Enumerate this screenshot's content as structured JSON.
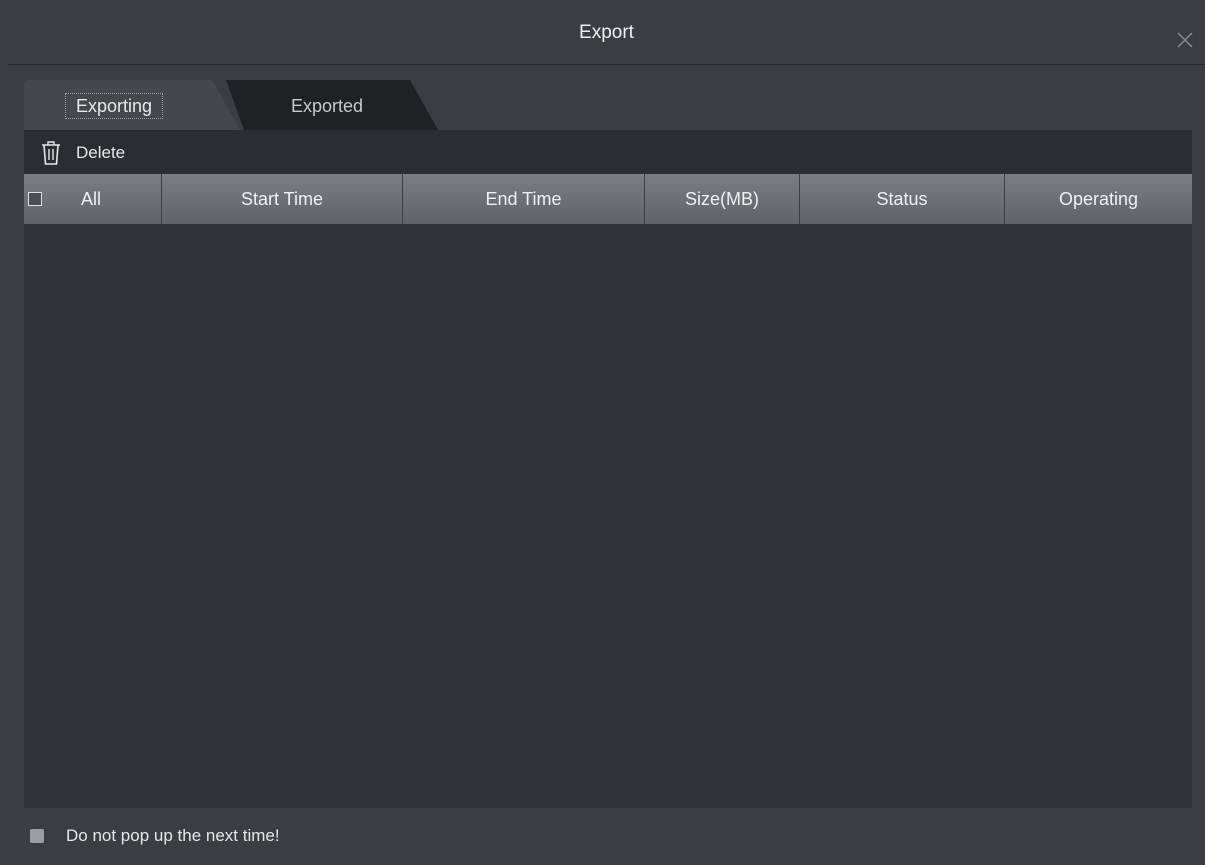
{
  "dialog": {
    "title": "Export"
  },
  "tabs": [
    {
      "label": "Exporting",
      "active": true
    },
    {
      "label": "Exported",
      "active": false
    }
  ],
  "toolbar": {
    "delete_label": "Delete",
    "delete_icon": "trash-icon"
  },
  "table": {
    "columns": [
      "All",
      "Start Time",
      "End Time",
      "Size(MB)",
      "Status",
      "Operating"
    ],
    "rows": []
  },
  "footer": {
    "dont_popup_label": "Do not pop up the next time!"
  },
  "colors": {
    "background": "#3a3d42",
    "panel": "#2f3236",
    "header": "#6e7277"
  }
}
